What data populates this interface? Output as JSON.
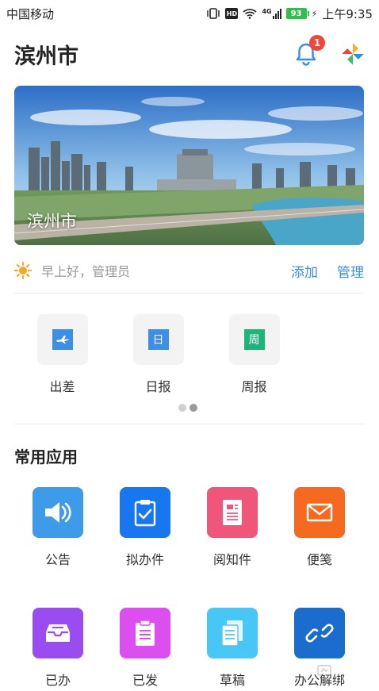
{
  "status_bar": {
    "carrier": "中国移动",
    "network": "4G",
    "battery": "93",
    "time": "上午9:35"
  },
  "header": {
    "title": "滨州市",
    "notification_count": "1"
  },
  "banner": {
    "caption": "滨州市"
  },
  "greeting": {
    "text": "早上好，管理员",
    "add_label": "添加",
    "manage_label": "管理"
  },
  "quick_items": [
    {
      "label": "出差",
      "icon": "plane-icon",
      "color": "#3d8ee6"
    },
    {
      "label": "日报",
      "icon_text": "日",
      "icon": "daily-report-icon",
      "color": "#3d8ee6"
    },
    {
      "label": "周报",
      "icon_text": "周",
      "icon": "weekly-report-icon",
      "color": "#1fb37a"
    }
  ],
  "pager": {
    "pages": 2,
    "active": 2
  },
  "common_apps": {
    "title": "常用应用",
    "items": [
      {
        "label": "公告",
        "icon": "speaker-icon",
        "color": "#3d9be9"
      },
      {
        "label": "拟办件",
        "icon": "clipboard-check-icon",
        "color": "#1677f0"
      },
      {
        "label": "阅知件",
        "icon": "document-icon",
        "color": "#f0567a"
      },
      {
        "label": "便笺",
        "icon": "mail-icon",
        "color": "#f56a1e"
      },
      {
        "label": "已办",
        "icon": "inbox-tray-icon",
        "color": "#9a4cf0"
      },
      {
        "label": "已发",
        "icon": "clipboard-list-icon",
        "color": "#dd4ef0"
      },
      {
        "label": "草稿",
        "icon": "documents-icon",
        "color": "#47c7f5"
      },
      {
        "label": "办公解绑",
        "icon": "unlink-icon",
        "color": "#1a6ccf"
      }
    ]
  }
}
